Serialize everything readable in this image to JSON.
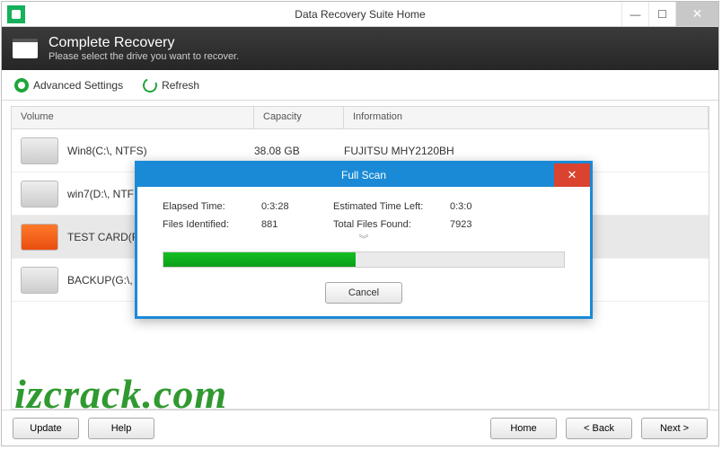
{
  "window": {
    "title": "Data Recovery Suite Home"
  },
  "banner": {
    "heading": "Complete Recovery",
    "sub": "Please select the drive you want to recover."
  },
  "toolbar": {
    "advanced": "Advanced Settings",
    "refresh": "Refresh"
  },
  "columns": {
    "volume": "Volume",
    "capacity": "Capacity",
    "info": "Information"
  },
  "drives": [
    {
      "name": "Win8(C:\\, NTFS)",
      "cap": "38.08 GB",
      "info": "FUJITSU MHY2120BH",
      "sel": false
    },
    {
      "name": "win7(D:\\, NTF",
      "cap": "",
      "info": "",
      "sel": false
    },
    {
      "name": "TEST CARD(F:",
      "cap": "",
      "info": "",
      "sel": true
    },
    {
      "name": "BACKUP(G:\\,",
      "cap": "",
      "info": "",
      "sel": false
    }
  ],
  "modal": {
    "title": "Full Scan",
    "elapsed_lbl": "Elapsed Time:",
    "elapsed": "0:3:28",
    "eta_lbl": "Estimated Time Left:",
    "eta": "0:3:0",
    "files_id_lbl": "Files Identified:",
    "files_id": "881",
    "total_lbl": "Total Files Found:",
    "total": "7923",
    "progress_pct": 48,
    "cancel": "Cancel"
  },
  "footer": {
    "update": "Update",
    "help": "Help",
    "home": "Home",
    "back": "< Back",
    "next": "Next >"
  },
  "watermark": "izcrack.com"
}
